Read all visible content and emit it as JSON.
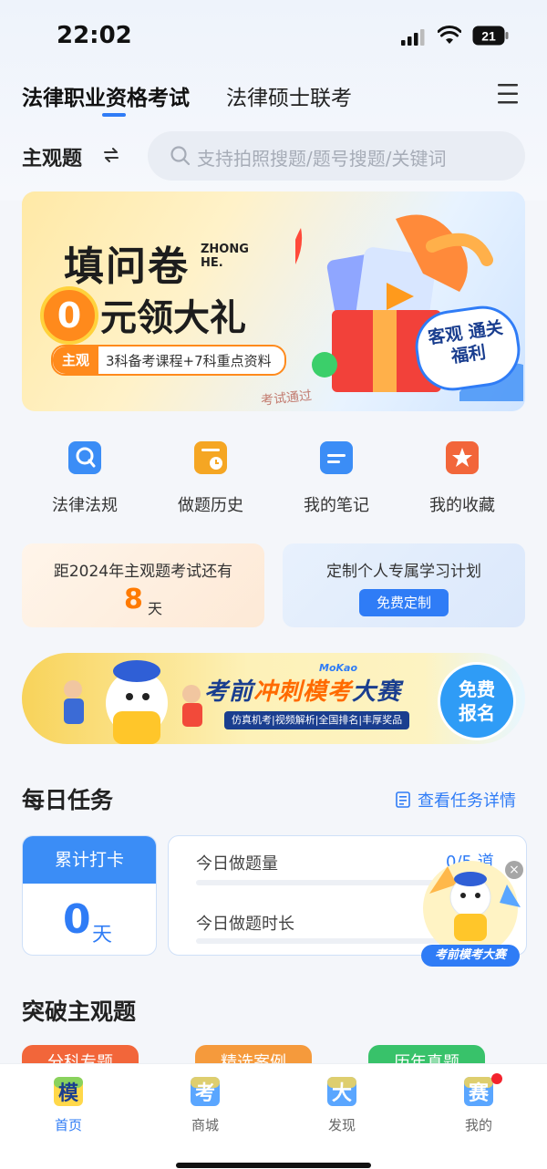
{
  "status_bar": {
    "time": "22:02",
    "battery": "21"
  },
  "header": {
    "tabs": [
      {
        "label": "法律职业资格考试",
        "active": true
      },
      {
        "label": "法律硕士联考",
        "active": false
      }
    ]
  },
  "subject": {
    "label": "主观题"
  },
  "search": {
    "placeholder": "支持拍照搜题/题号搜题/关键词"
  },
  "banner": {
    "title_line1": "填问卷",
    "brand": "ZHONG HE.",
    "zero": "0",
    "title_line2": "元领大礼",
    "tag_badge": "主观",
    "tag_text": "3科备考课程+7科重点资料",
    "stamp": "考试通过",
    "cloud_text": "客观 通关福利"
  },
  "quick_links": [
    {
      "label": "法律法规",
      "icon": "law-book-icon",
      "color": "#3b8df6"
    },
    {
      "label": "做题历史",
      "icon": "history-icon",
      "color": "#f5a623"
    },
    {
      "label": "我的笔记",
      "icon": "note-icon",
      "color": "#3b8df6"
    },
    {
      "label": "我的收藏",
      "icon": "star-icon",
      "color": "#f2663a"
    }
  ],
  "countdown": {
    "label": "距2024年主观题考试还有",
    "value": "8",
    "unit": "天"
  },
  "plan": {
    "label": "定制个人专属学习计划",
    "button": "免费定制"
  },
  "contest": {
    "brand": "MoKao",
    "title_a": "考前",
    "title_b": "冲刺模考",
    "title_c": "大赛",
    "subtitle": "仿真机考|视频解析|全国排名|丰厚奖品",
    "button": "免费报名"
  },
  "daily": {
    "title": "每日任务",
    "link": "查看任务详情",
    "checkin_label": "累计打卡",
    "checkin_value": "0",
    "checkin_unit": "天",
    "today_questions_label": "今日做题量",
    "today_questions_value": "0/5 道",
    "today_time_label": "今日做题时长"
  },
  "float_ad": {
    "label": "考前模考大赛",
    "close": "×"
  },
  "breakthrough": {
    "title": "突破主观题",
    "chips": [
      "分科专题",
      "精选案例",
      "历年真题"
    ]
  },
  "tabbar": [
    {
      "label": "首页",
      "glyph": "模",
      "active": true
    },
    {
      "label": "商城",
      "glyph": "考",
      "active": false
    },
    {
      "label": "发现",
      "glyph": "大",
      "active": false
    },
    {
      "label": "我的",
      "glyph": "赛",
      "active": false,
      "badge": true
    }
  ],
  "colors": {
    "accent": "#2f7cf6",
    "orange": "#ff7a00"
  }
}
